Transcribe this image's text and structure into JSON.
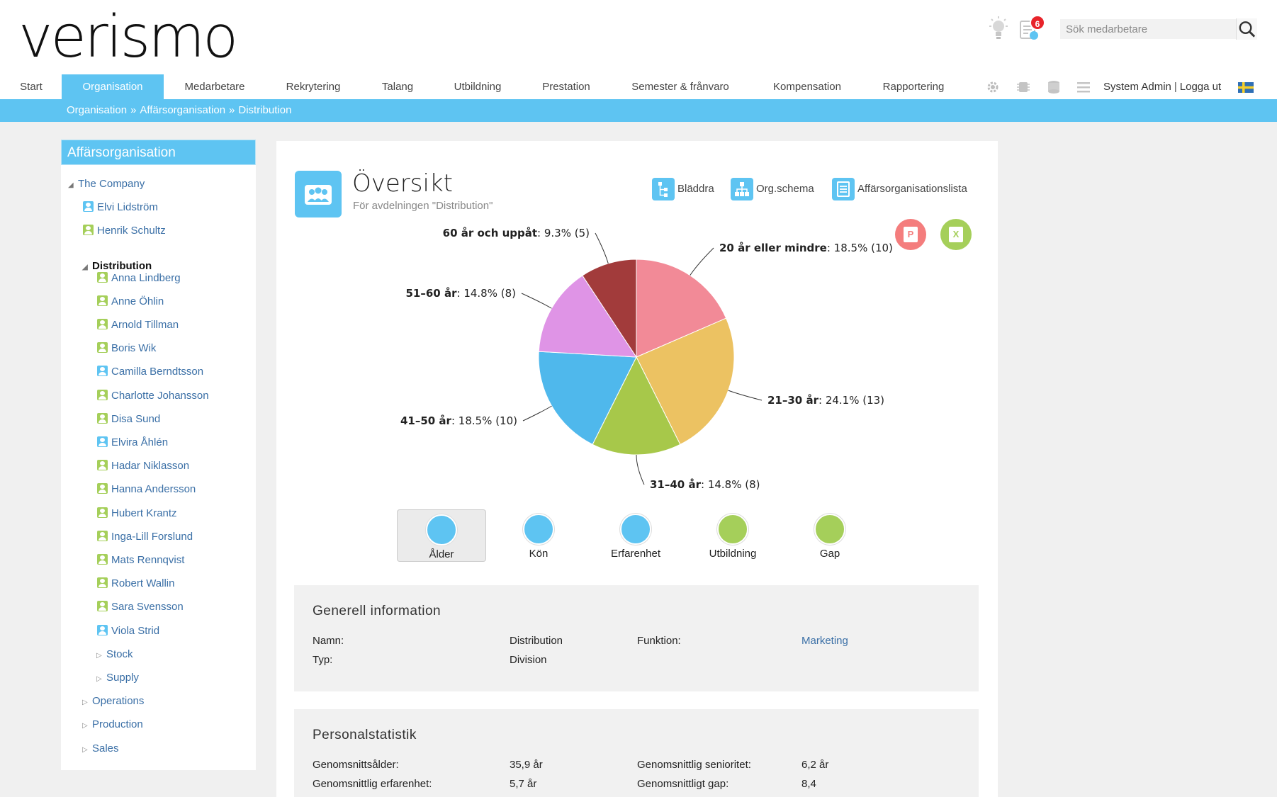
{
  "app": {
    "logo_text": "verismo"
  },
  "header": {
    "notifications_count": "6",
    "search_placeholder": "Sök medarbetare"
  },
  "nav": {
    "items": [
      "Start",
      "Organisation",
      "Medarbetare",
      "Rekrytering",
      "Talang",
      "Utbildning",
      "Prestation",
      "Semester & frånvaro",
      "Kompensation",
      "Rapportering"
    ],
    "active": "Organisation",
    "user_name": "System Admin",
    "logout_label": "Logga ut"
  },
  "breadcrumb": [
    "Organisation",
    "Affärsorganisation",
    "Distribution"
  ],
  "sidebar": {
    "title": "Affärsorganisation",
    "root": "The Company",
    "root_people": [
      {
        "name": "Elvi Lidström",
        "type": "m"
      },
      {
        "name": "Henrik Schultz",
        "type": "f"
      }
    ],
    "selected": "Distribution",
    "members": [
      {
        "name": "Anna Lindberg",
        "type": "f"
      },
      {
        "name": "Anne Öhlin",
        "type": "f"
      },
      {
        "name": "Arnold Tillman",
        "type": "f"
      },
      {
        "name": "Boris Wik",
        "type": "f"
      },
      {
        "name": "Camilla Berndtsson",
        "type": "m"
      },
      {
        "name": "Charlotte Johansson",
        "type": "f"
      },
      {
        "name": "Disa Sund",
        "type": "f"
      },
      {
        "name": "Elvira Åhlén",
        "type": "m"
      },
      {
        "name": "Hadar Niklasson",
        "type": "f"
      },
      {
        "name": "Hanna Andersson",
        "type": "f"
      },
      {
        "name": "Hubert Krantz",
        "type": "f"
      },
      {
        "name": "Inga-Lill Forslund",
        "type": "f"
      },
      {
        "name": "Mats Rennqvist",
        "type": "f"
      },
      {
        "name": "Robert Wallin",
        "type": "f"
      },
      {
        "name": "Sara Svensson",
        "type": "f"
      },
      {
        "name": "Viola Strid",
        "type": "m"
      }
    ],
    "sub_units": [
      "Stock",
      "Supply"
    ],
    "siblings": [
      "Operations",
      "Production",
      "Sales"
    ]
  },
  "overview": {
    "title": "Översikt",
    "subtitle": "För avdelningen \"Distribution\"",
    "actions": [
      "Bläddra",
      "Org.schema",
      "Affärsorganisationslista"
    ],
    "export_ppt": "P",
    "export_xls": "X"
  },
  "chart_data": {
    "type": "pie",
    "slices": [
      {
        "label": "20 år eller mindre",
        "percent": 18.5,
        "count": 10,
        "display": "18.5% (10)",
        "color": "#f28a97"
      },
      {
        "label": "21–30 år",
        "percent": 24.1,
        "count": 13,
        "display": "24.1% (13)",
        "color": "#ecc262"
      },
      {
        "label": "31–40 år",
        "percent": 14.8,
        "count": 8,
        "display": "14.8% (8)",
        "color": "#a7c84a"
      },
      {
        "label": "41–50 år",
        "percent": 18.5,
        "count": 10,
        "display": "18.5% (10)",
        "color": "#4fb8ec"
      },
      {
        "label": "51–60 år",
        "percent": 14.8,
        "count": 8,
        "display": "14.8% (8)",
        "color": "#df94e6"
      },
      {
        "label": "60 år och uppåt",
        "percent": 9.3,
        "count": 5,
        "display": "9.3% (5)",
        "color": "#a23b3b"
      }
    ]
  },
  "tabs": [
    {
      "label": "Ålder",
      "active": true,
      "color": "#5ec4f2"
    },
    {
      "label": "Kön",
      "active": false,
      "color": "#5ec4f2"
    },
    {
      "label": "Erfarenhet",
      "active": false,
      "color": "#5ec4f2"
    },
    {
      "label": "Utbildning",
      "active": false,
      "color": "#a5cf5a"
    },
    {
      "label": "Gap",
      "active": false,
      "color": "#a5cf5a"
    }
  ],
  "general_info": {
    "title": "Generell information",
    "name_label": "Namn:",
    "name_value": "Distribution",
    "type_label": "Typ:",
    "type_value": "Division",
    "function_label": "Funktion:",
    "function_value": "Marketing"
  },
  "staff_stats": {
    "title": "Personalstatistik",
    "avg_age_label": "Genomsnittsålder:",
    "avg_age_value": "35,9 år",
    "avg_experience_label": "Genomsnittlig erfarenhet:",
    "avg_experience_value": "5,7 år",
    "avg_seniority_label": "Genomsnittlig senioritet:",
    "avg_seniority_value": "6,2 år",
    "avg_gap_label": "Genomsnittligt gap:",
    "avg_gap_value": "8,4"
  }
}
